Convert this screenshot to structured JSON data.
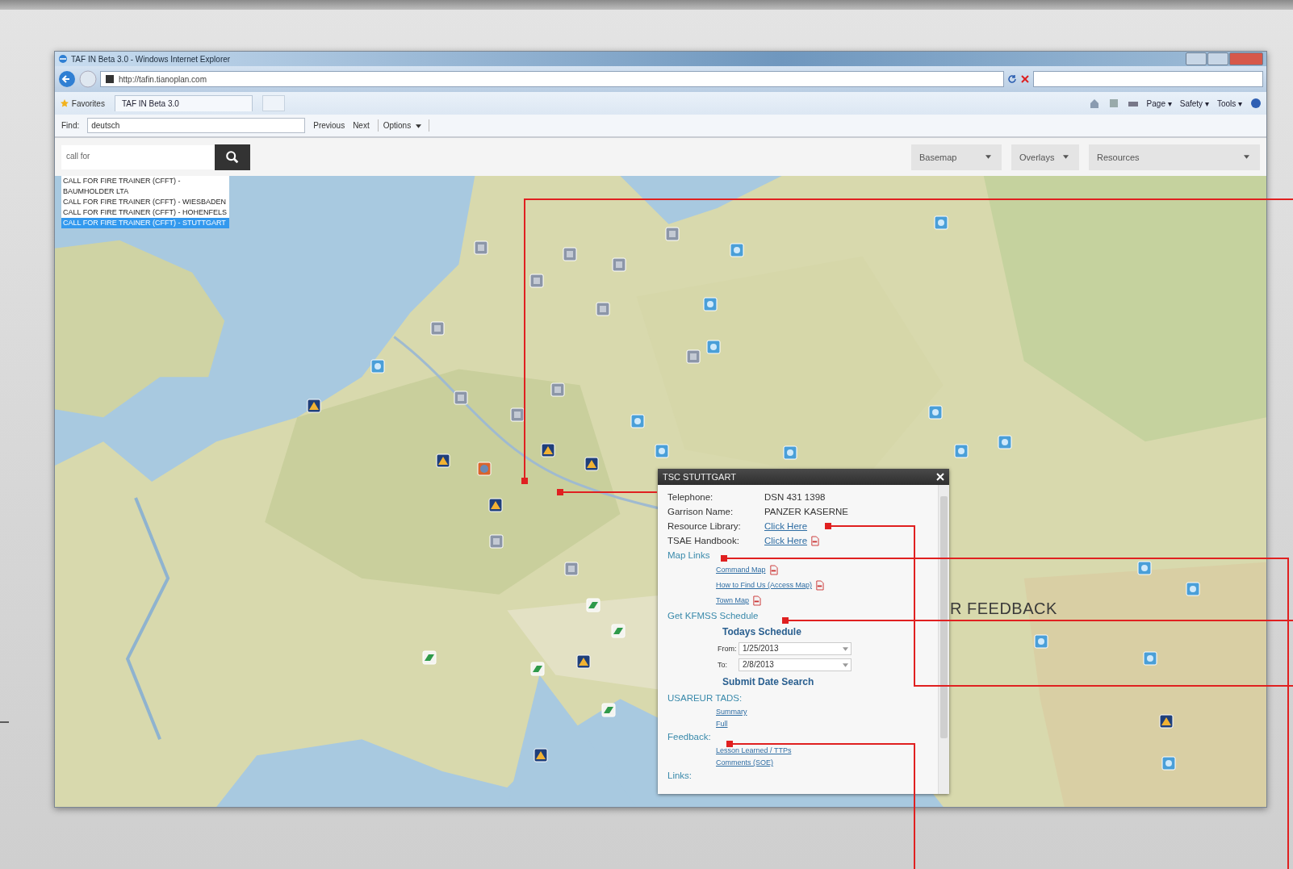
{
  "browser": {
    "title": "TAF IN Beta 3.0 - Windows Internet Explorer",
    "address": "http://tafin.tianoplan.com",
    "favorites": "Favorites",
    "tab": "TAF IN Beta 3.0",
    "commands": [
      "Page ▾",
      "Safety ▾",
      "Tools ▾"
    ],
    "find": {
      "label": "Find:",
      "value": "deutsch",
      "previous": "Previous",
      "next": "Next",
      "options": "Options"
    }
  },
  "app": {
    "search": {
      "value": "call for"
    },
    "suggestions": [
      {
        "text": "CALL FOR FIRE TRAINER (CFFT) - BAUMHOLDER LTA",
        "selected": false
      },
      {
        "text": "CALL FOR FIRE TRAINER (CFFT) - WIESBADEN",
        "selected": false
      },
      {
        "text": "CALL FOR FIRE TRAINER (CFFT) - HOHENFELS",
        "selected": false
      },
      {
        "text": "CALL FOR FIRE TRAINER (CFFT) - STUTTGART",
        "selected": true
      }
    ],
    "menus": [
      "Basemap",
      "Overlays",
      "Resources"
    ]
  },
  "popup": {
    "title": "TSC STUTTGART",
    "fields": [
      {
        "label": "Telephone:",
        "value": "DSN 431 1398",
        "kind": "text",
        "pdf": false
      },
      {
        "label": "Garrison Name:",
        "value": "PANZER KASERNE",
        "kind": "text",
        "pdf": false
      },
      {
        "label": "Resource Library:",
        "value": "Click Here",
        "kind": "link",
        "pdf": false
      },
      {
        "label": "TSAE Handbook:",
        "value": "Click Here",
        "kind": "link",
        "pdf": true
      }
    ],
    "map_links": {
      "heading": "Map Links",
      "links": [
        {
          "text": "Command Map",
          "pdf": true
        },
        {
          "text": "How to Find Us (Access Map)",
          "pdf": true
        },
        {
          "text": "Town Map",
          "pdf": true
        }
      ]
    },
    "schedule": {
      "heading": "Get KFMSS Schedule",
      "title": "Todays Schedule",
      "from_label": "From:",
      "from": "1/25/2013",
      "to_label": "To:",
      "to": "2/8/2013",
      "submit": "Submit Date Search"
    },
    "tads": {
      "heading": "USAREUR TADS:",
      "links": [
        "Summary",
        "Full"
      ]
    },
    "feedback": {
      "heading": "Feedback:",
      "links": [
        "Lesson Learned / TTPs",
        "Comments (SOE)"
      ]
    },
    "links_heading": "Links:"
  },
  "annotation": "R FEEDBACK"
}
